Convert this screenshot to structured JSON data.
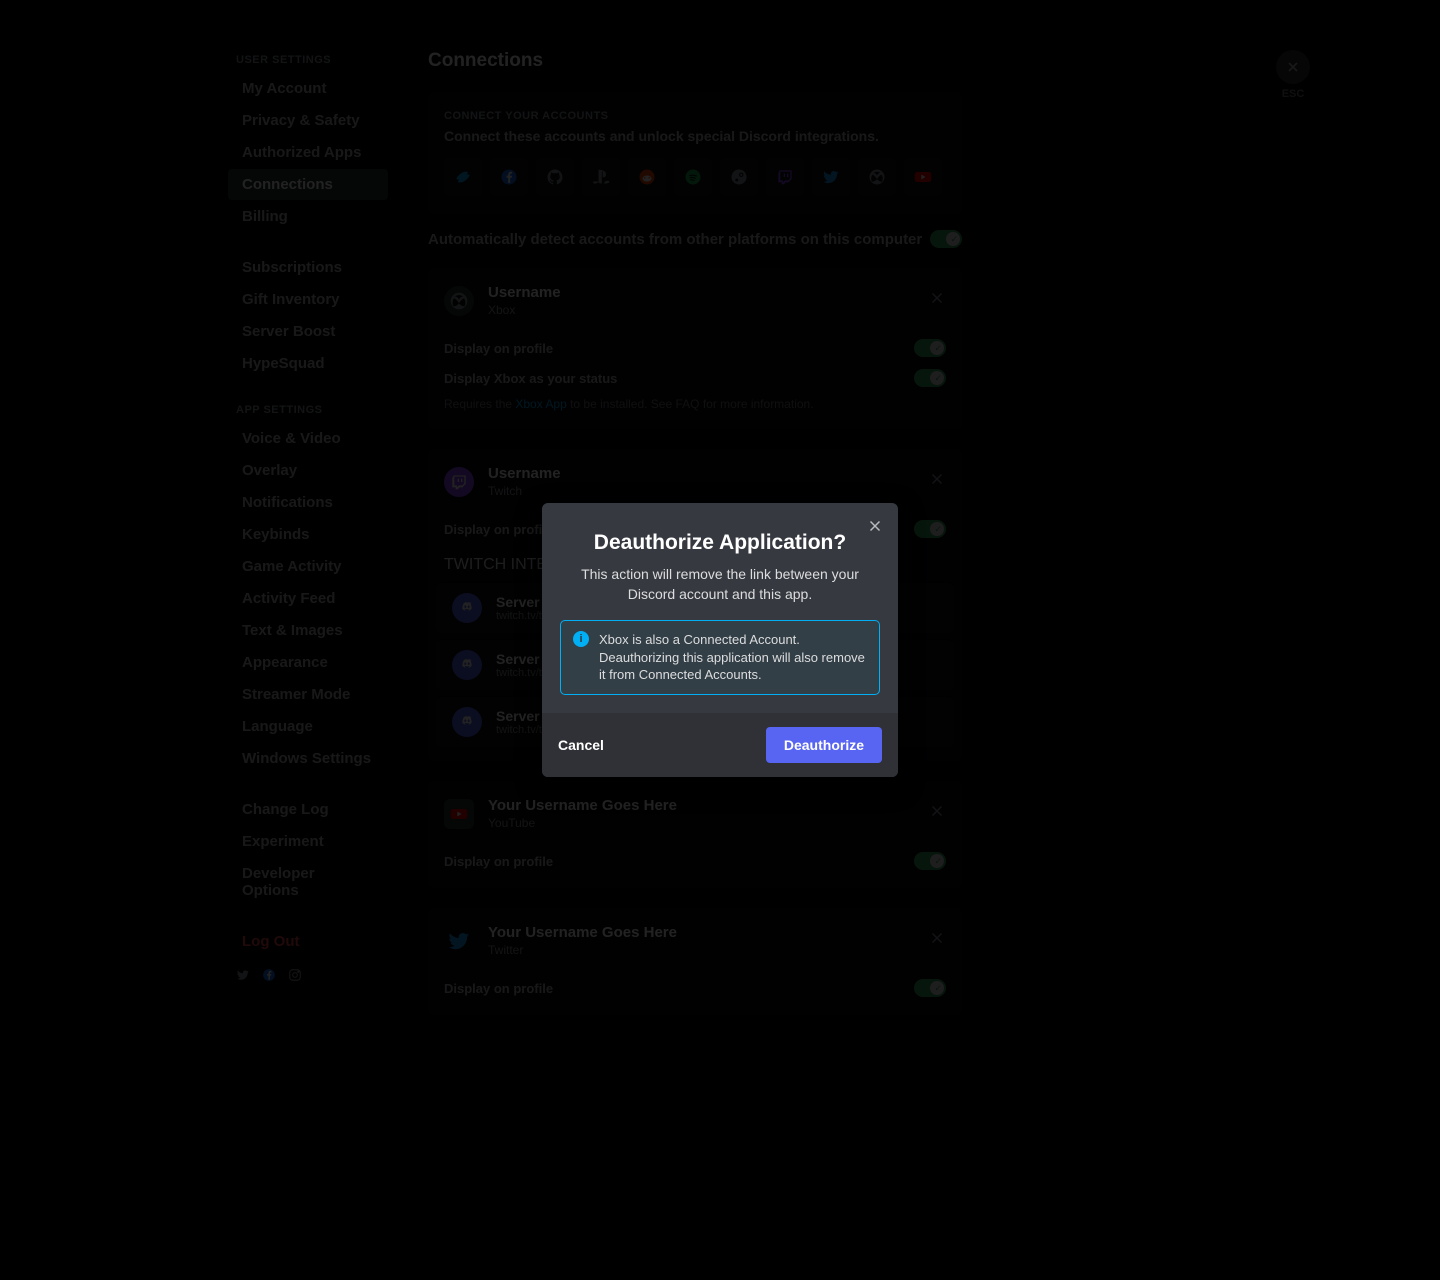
{
  "sidebar": {
    "cat_user": "USER SETTINGS",
    "cat_app": "APP SETTINGS",
    "items": [
      "My Account",
      "Privacy & Safety",
      "Authorized Apps",
      "Connections",
      "Billing",
      "Subscriptions",
      "Gift Inventory",
      "Server Boost",
      "HypeSquad",
      "Voice & Video",
      "Overlay",
      "Notifications",
      "Keybinds",
      "Game Activity",
      "Activity Feed",
      "Text & Images",
      "Appearance",
      "Streamer Mode",
      "Language",
      "Windows Settings",
      "Change Log",
      "Experiment",
      "Developer Options",
      "Log Out"
    ]
  },
  "esc_label": "ESC",
  "page": {
    "title": "Connections",
    "connect_heading": "CONNECT YOUR ACCOUNTS",
    "connect_desc": "Connect these accounts and unlock special Discord integrations.",
    "autodetect": "Automatically detect accounts from other platforms on this computer"
  },
  "integrations": [
    "battlenet",
    "facebook",
    "github",
    "playstation",
    "reddit",
    "spotify",
    "steam",
    "twitch",
    "twitter",
    "xbox",
    "youtube"
  ],
  "cards": [
    {
      "username": "Username",
      "service": "Xbox",
      "rows": [
        {
          "label": "Display on profile"
        },
        {
          "label": "Display Xbox as your status"
        }
      ],
      "note_prefix": "Requires the ",
      "note_link": "Xbox App",
      "note_suffix": " to be installed. See FAQ for more information."
    },
    {
      "username": "Username",
      "service": "Twitch",
      "rows": [
        {
          "label": "Display on profile"
        }
      ],
      "servers_heading": "TWITCH INTEGRATION SERVERS",
      "servers": [
        {
          "name": "Server Name",
          "link": "twitch.tv/twitch"
        },
        {
          "name": "Server Name",
          "link": "twitch.tv/twitch"
        },
        {
          "name": "Server Name",
          "link": "twitch.tv/twitch"
        }
      ]
    },
    {
      "username": "Your Username Goes Here",
      "service": "YouTube",
      "rows": [
        {
          "label": "Display on profile"
        }
      ]
    },
    {
      "username": "Your Username Goes Here",
      "service": "Twitter",
      "rows": [
        {
          "label": "Display on profile"
        }
      ]
    }
  ],
  "modal": {
    "title": "Deauthorize Application?",
    "subtitle": "This action will remove the link between your Discord account and this app.",
    "info": "Xbox is also a Connected Account. Deauthorizing this application will also remove it from Connected Accounts.",
    "cancel": "Cancel",
    "confirm": "Deauthorize"
  },
  "colors": {
    "accent": "#5865f2",
    "green": "#3ba55c",
    "info": "#00aff4",
    "danger": "#f04747"
  }
}
